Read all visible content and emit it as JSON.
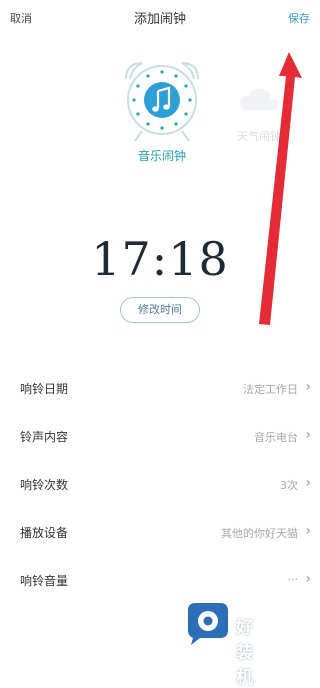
{
  "topbar": {
    "cancel": "取消",
    "title": "添加闹钟",
    "save": "保存"
  },
  "alarm_types": [
    {
      "label": "音乐闹钟",
      "icon": "music-note-icon",
      "selected": true
    },
    {
      "label": "天气闹钟",
      "icon": "weather-cloud-icon",
      "selected": false
    }
  ],
  "time": "17:18",
  "modify_time_button": "修改时间",
  "settings": [
    {
      "label": "响铃日期",
      "value": "法定工作日"
    },
    {
      "label": "铃声内容",
      "value": "音乐电台"
    },
    {
      "label": "响铃次数",
      "value": "3次"
    },
    {
      "label": "播放设备",
      "value": "其他的你好天猫"
    },
    {
      "label": "响铃音量",
      "value": "···"
    }
  ],
  "watermark": {
    "text": "好装机"
  },
  "colors": {
    "accent": "#2a9fb8",
    "save": "#3a9fd0",
    "annotation_arrow": "#e52b35"
  }
}
